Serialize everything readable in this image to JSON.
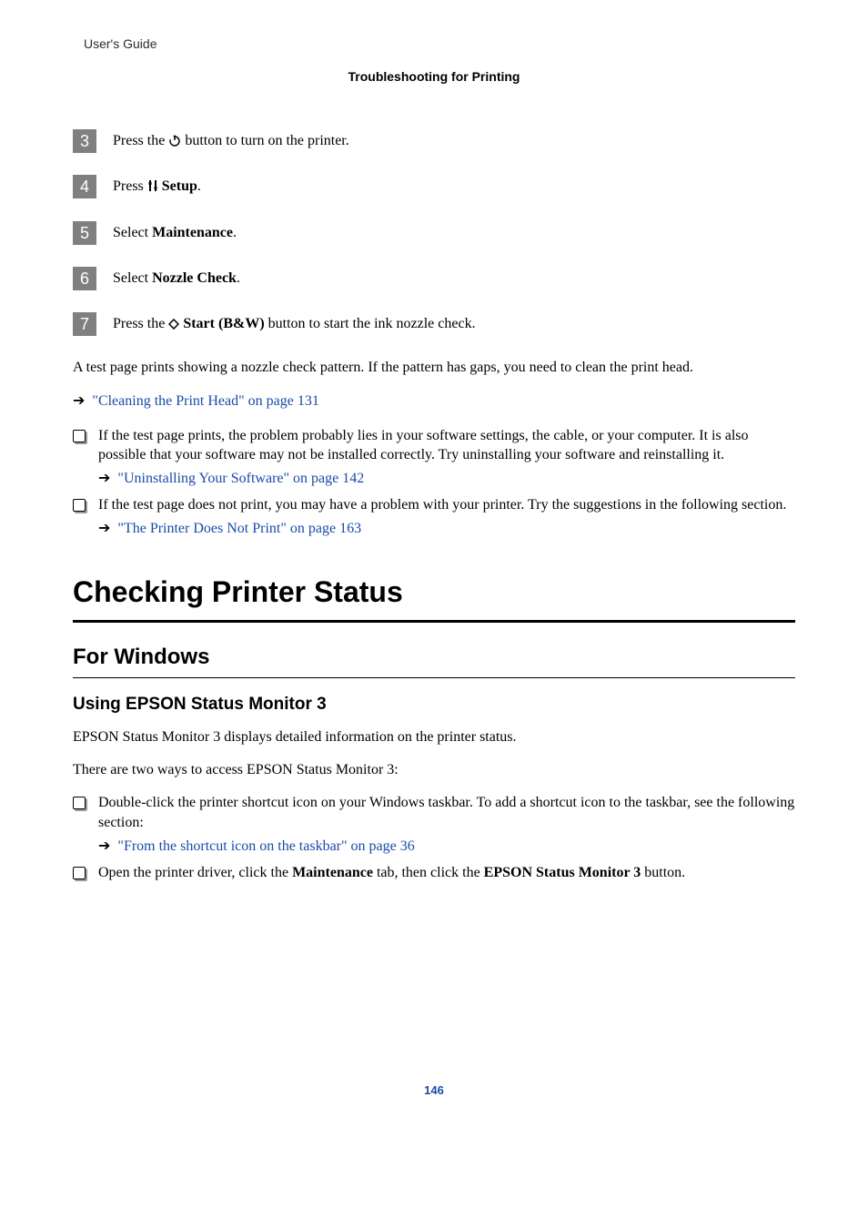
{
  "header": {
    "breadcrumb_head": "User's Guide",
    "section_title": "Troubleshooting for Printing"
  },
  "steps": [
    {
      "num": "3",
      "pre": "Press the ",
      "icon": "power-icon",
      "post": " button to turn on the printer."
    },
    {
      "num": "4",
      "pre": "Press ",
      "icon": "setup-icon",
      "bold": " Setup",
      "post": "."
    },
    {
      "num": "5",
      "pre": "Select ",
      "bold": "Maintenance",
      "post": "."
    },
    {
      "num": "6",
      "pre": "Select ",
      "bold": "Nozzle Check",
      "post": "."
    },
    {
      "num": "7",
      "pre": "Press the ",
      "icon": "diamond-icon",
      "bold": " Start (B&W)",
      "post": " button to start the ink nozzle check."
    }
  ],
  "para_after_steps": "A test page prints showing a nozzle check pattern. If the pattern has gaps, you need to clean the print head.",
  "link1": "\"Cleaning the Print Head\" on page 131",
  "bullets1": [
    {
      "text": "If the test page prints, the problem probably lies in your software settings, the cable, or your computer. It is also possible that your software may not be installed correctly. Try uninstalling your software and reinstalling it.",
      "link": "\"Uninstalling Your Software\" on page 142"
    },
    {
      "text": "If the test page does not print, you may have a problem with your printer. Try the suggestions in the following section.",
      "link": "\"The Printer Does Not Print\" on page 163"
    }
  ],
  "h1": "Checking Printer Status",
  "h2": "For Windows",
  "h3": "Using EPSON Status Monitor 3",
  "para_sm1": "EPSON Status Monitor 3 displays detailed information on the printer status.",
  "para_sm2": "There are two ways to access EPSON Status Monitor 3:",
  "bullets2": [
    {
      "text": "Double-click the printer shortcut icon on your Windows taskbar. To add a shortcut icon to the taskbar, see the following section:",
      "link": "\"From the shortcut icon on the taskbar\" on page 36"
    },
    {
      "pre": "Open the printer driver, click the ",
      "bold1": "Maintenance",
      "mid": " tab, then click the ",
      "bold2": "EPSON Status Monitor 3",
      "post": " button."
    }
  ],
  "page_num": "146"
}
